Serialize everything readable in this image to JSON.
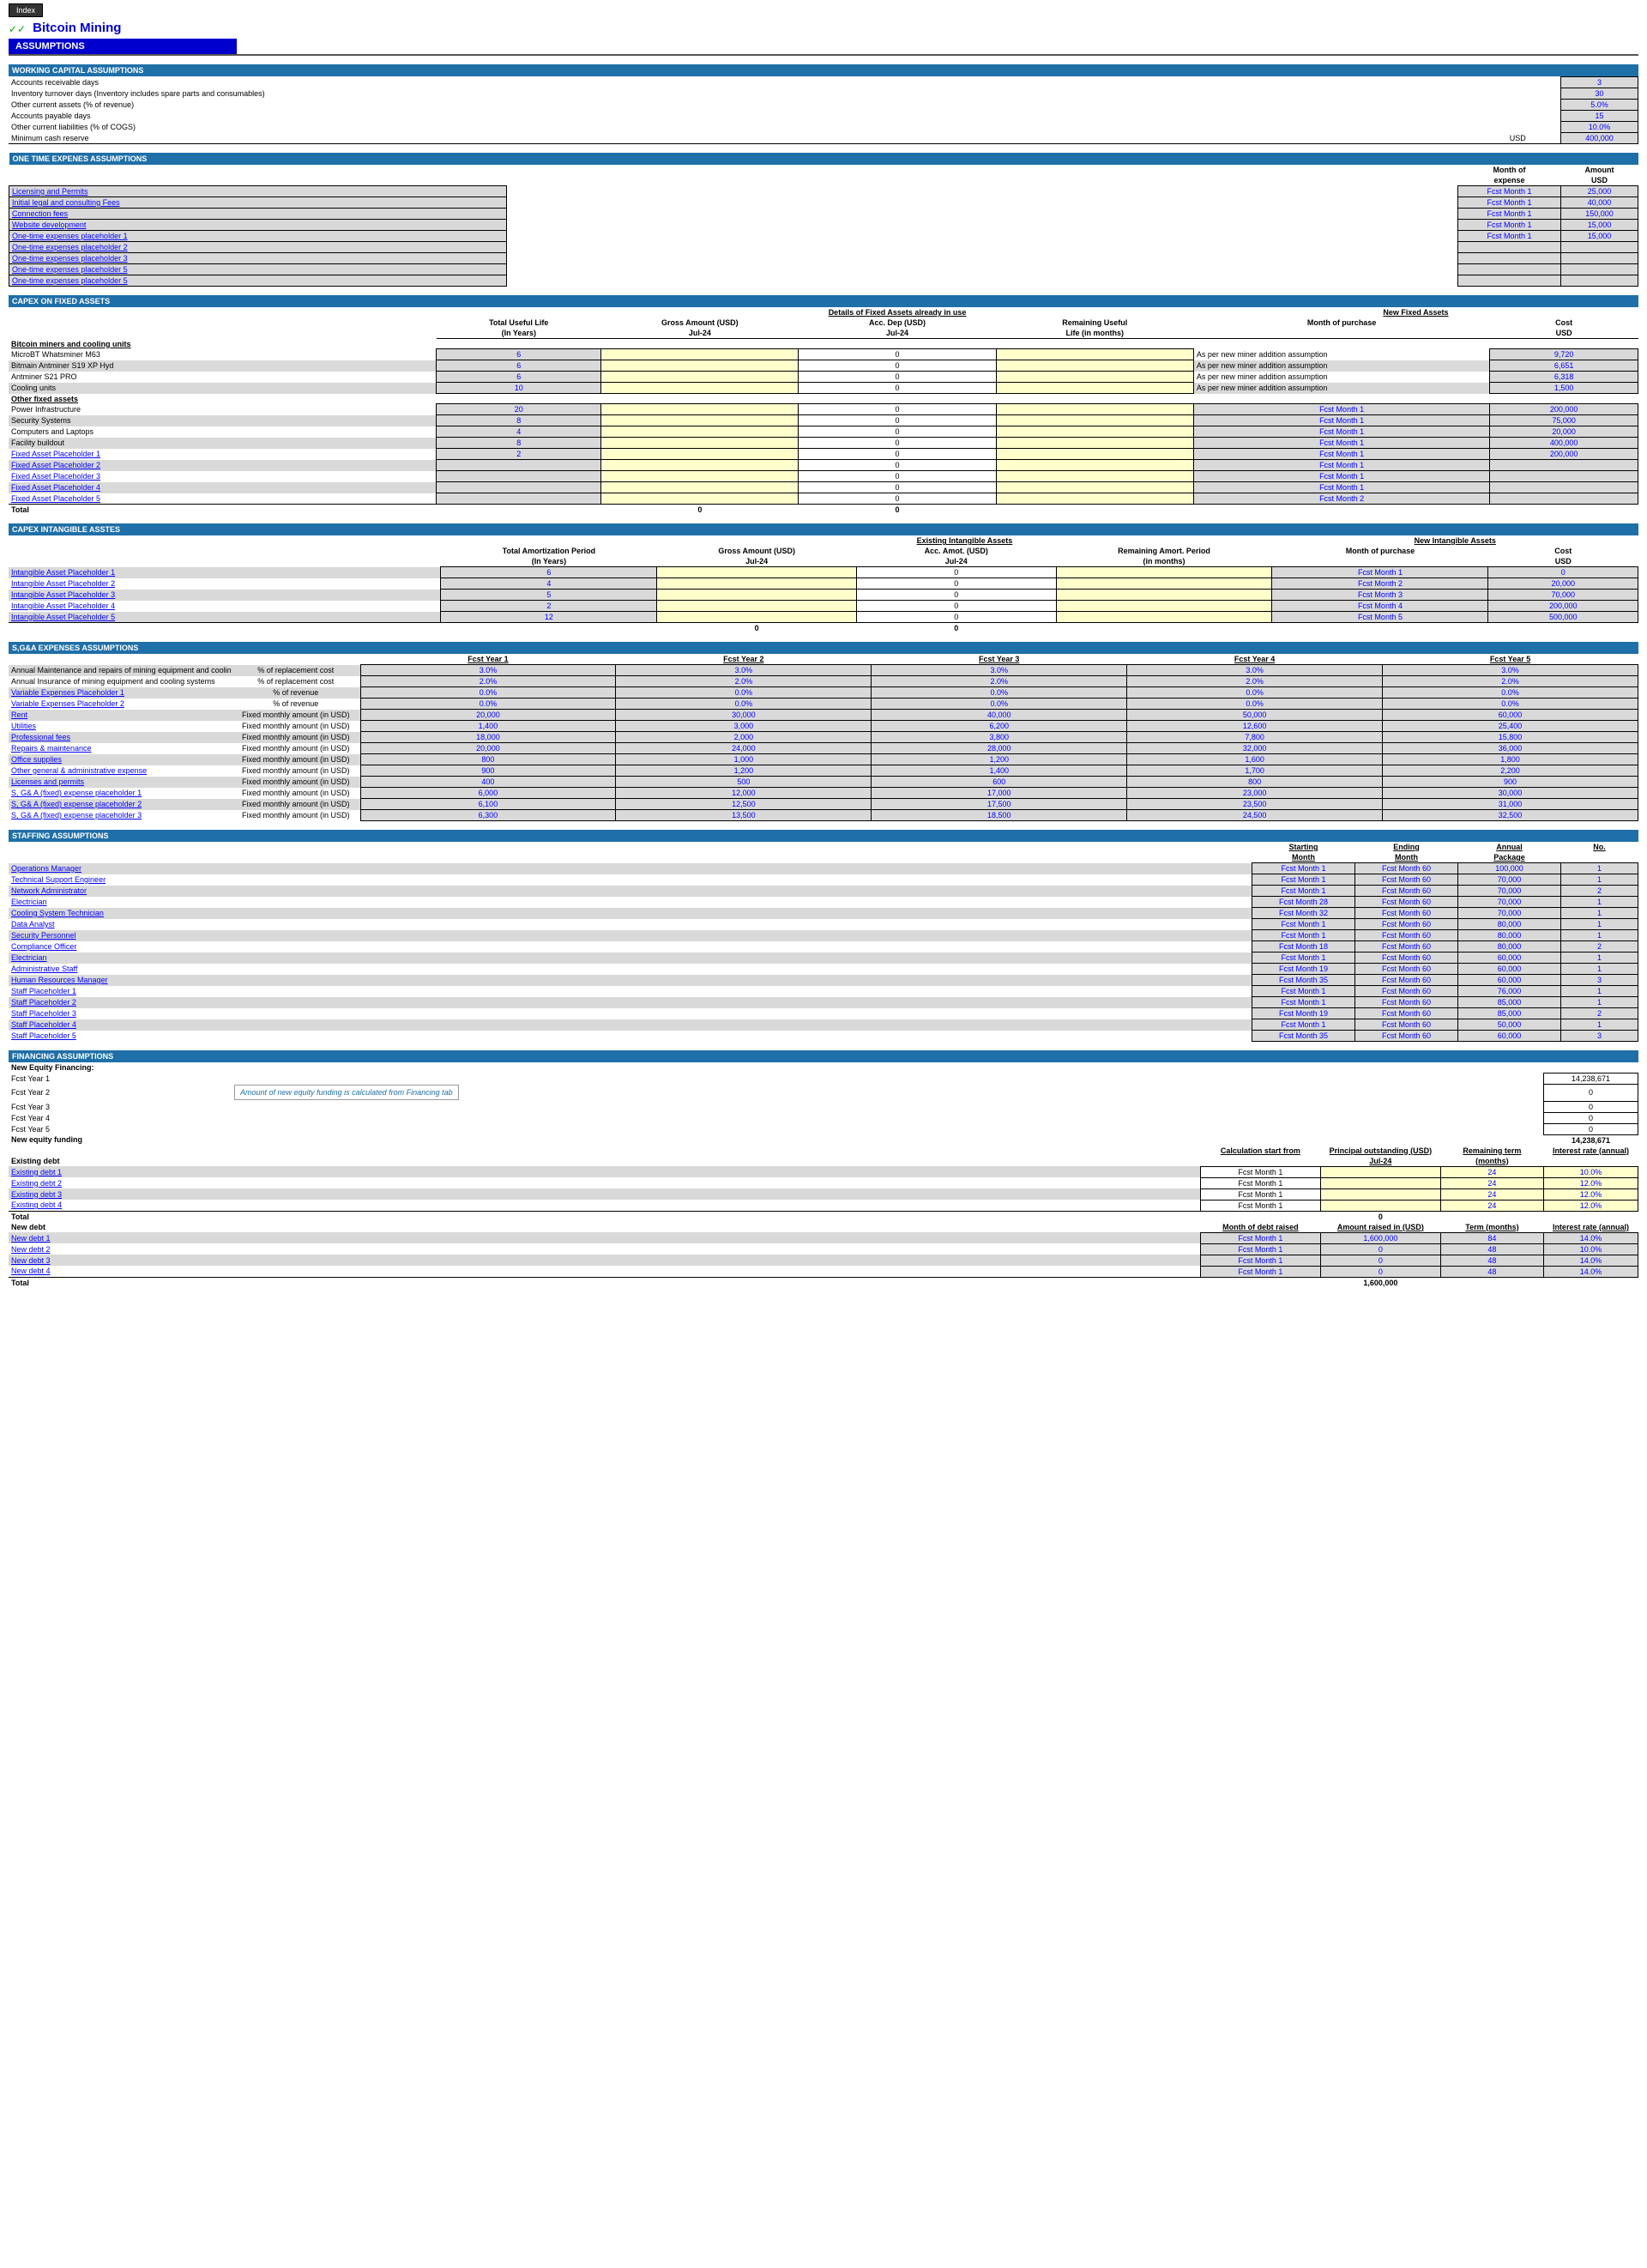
{
  "title": "Bitcoin Mining",
  "index": "Index",
  "assumptions": "ASSUMPTIONS",
  "wc": {
    "hdr": "WORKING CAPITAL ASSUMPTIONS",
    "rows": [
      {
        "l": "Accounts receivable days",
        "u": "",
        "v": "3"
      },
      {
        "l": "Inventory turnover days (Inventory includes spare parts and consumables)",
        "u": "",
        "v": "30"
      },
      {
        "l": "Other current assets (% of revenue)",
        "u": "",
        "v": "5.0%"
      },
      {
        "l": "Accounts payable days",
        "u": "",
        "v": "15"
      },
      {
        "l": "Other current liabilities (% of COGS)",
        "u": "",
        "v": "10.0%"
      },
      {
        "l": "Minimum cash reserve",
        "u": "USD",
        "v": "400,000"
      }
    ]
  },
  "ote": {
    "hdr": "ONE TIME EXPENES ASSUMPTIONS",
    "h1": "Month of",
    "h1b": "expense",
    "h2": "Amount",
    "h2b": "USD",
    "rows": [
      {
        "l": "Licensing and Permits",
        "m": "Fcst Month 1",
        "a": "25,000"
      },
      {
        "l": "Initial legal and consulting Fees",
        "m": "Fcst Month 1",
        "a": "40,000"
      },
      {
        "l": "Connection fees",
        "m": "Fcst Month 1",
        "a": "150,000"
      },
      {
        "l": "Website development",
        "m": "Fcst Month 1",
        "a": "15,000"
      },
      {
        "l": "One-time expenses placeholder 1",
        "m": "Fcst Month 1",
        "a": "15,000"
      },
      {
        "l": "One-time expenses placeholder 2",
        "m": "",
        "a": ""
      },
      {
        "l": "One-time expenses placeholder 3",
        "m": "",
        "a": ""
      },
      {
        "l": "One-time expenses placeholder 5",
        "m": "",
        "a": ""
      },
      {
        "l": "One-time expenses placeholder 5",
        "m": "",
        "a": ""
      }
    ]
  },
  "capfa": {
    "hdr": "CAPEX ON FIXED ASSETS",
    "h_det": "Details of Fixed Assets already in use",
    "h_new": "New Fixed Assets",
    "col1": "Total Useful Life",
    "col1b": "(In Years)",
    "col2": "Gross Amount (USD)",
    "col2b": "Jul-24",
    "col3": "Acc. Dep (USD)",
    "col3b": "Jul-24",
    "col4": "Remaining Useful",
    "col4b": "Life (in months)",
    "col5": "Month of purchase",
    "col6": "Cost",
    "col6b": "USD",
    "sub1": "Bitcoin miners and cooling units",
    "sub2": "Other fixed assets",
    "total": "Total",
    "miners": [
      {
        "l": "MicroBT Whatsminer M63",
        "y": "6",
        "dep": "0",
        "mop": "As per new miner addition assumption",
        "c": "9,720"
      },
      {
        "l": "Bitmain Antminer S19 XP Hyd",
        "y": "6",
        "dep": "0",
        "mop": "As per new miner addition assumption",
        "c": "6,651"
      },
      {
        "l": "Antminer S21 PRO",
        "y": "6",
        "dep": "0",
        "mop": "As per new miner addition assumption",
        "c": "6,318"
      },
      {
        "l": "Cooling units",
        "y": "10",
        "dep": "0",
        "mop": "As per new miner addition assumption",
        "c": "1,500"
      }
    ],
    "other": [
      {
        "l": "Power Infrastructure",
        "y": "20",
        "dep": "0",
        "mop": "Fcst Month 1",
        "c": "200,000"
      },
      {
        "l": "Security Systems",
        "y": "8",
        "dep": "0",
        "mop": "Fcst Month 1",
        "c": "75,000"
      },
      {
        "l": "Computers and Laptops",
        "y": "4",
        "dep": "0",
        "mop": "Fcst Month 1",
        "c": "20,000"
      },
      {
        "l": "Facility buildout",
        "y": "8",
        "dep": "0",
        "mop": "Fcst Month 1",
        "c": "400,000"
      },
      {
        "l": "Fixed Asset Placeholder 1",
        "y": "2",
        "dep": "0",
        "mop": "Fcst Month 1",
        "c": "200,000"
      },
      {
        "l": "Fixed Asset Placeholder 2",
        "y": "",
        "dep": "0",
        "mop": "Fcst Month 1",
        "c": ""
      },
      {
        "l": "Fixed Asset Placeholder 3",
        "y": "",
        "dep": "0",
        "mop": "Fcst Month 1",
        "c": ""
      },
      {
        "l": "Fixed Asset Placeholder 4",
        "y": "",
        "dep": "0",
        "mop": "Fcst Month 1",
        "c": ""
      },
      {
        "l": "Fixed Asset Placeholder 5",
        "y": "",
        "dep": "0",
        "mop": "Fcst Month 2",
        "c": ""
      }
    ],
    "tot_g": "0",
    "tot_d": "0"
  },
  "capia": {
    "hdr": "CAPEX INTANGIBLE ASSTES",
    "h_exist": "Existing Intangible Assets",
    "h_new": "New Intangible Assets",
    "col1": "Total Amortization Period",
    "col1b": "(In Years)",
    "col2": "Gross Amount (USD)",
    "col2b": "Jul-24",
    "col3": "Acc. Amot. (USD)",
    "col3b": "Jul-24",
    "col4": "Remaining Amort. Period",
    "col4b": "(in months)",
    "col5": "Month of purchase",
    "col6": "Cost",
    "col6b": "USD",
    "rows": [
      {
        "l": "Intangible Asset Placeholder 1",
        "y": "6",
        "dep": "0",
        "mop": "Fcst Month 1",
        "c": "0"
      },
      {
        "l": "Intangible Asset Placeholder 2",
        "y": "4",
        "dep": "0",
        "mop": "Fcst Month 2",
        "c": "20,000"
      },
      {
        "l": "Intangible Asset Placeholder 3",
        "y": "5",
        "dep": "0",
        "mop": "Fcst Month 3",
        "c": "70,000"
      },
      {
        "l": "Intangible Asset Placeholder 4",
        "y": "2",
        "dep": "0",
        "mop": "Fcst Month 4",
        "c": "200,000"
      },
      {
        "l": "Intangible Asset Placeholder 5",
        "y": "12",
        "dep": "0",
        "mop": "Fcst Month 5",
        "c": "500,000"
      }
    ],
    "tot_g": "0",
    "tot_d": "0"
  },
  "sga": {
    "hdr": "S,G&A EXPENSES ASSUMPTIONS",
    "yrs": [
      "Fcst Year 1",
      "Fcst Year 2",
      "Fcst Year 3",
      "Fcst Year 4",
      "Fcst Year 5"
    ],
    "rows": [
      {
        "l": "Annual Maintenance and repairs of  mining equipment and cooling systems",
        "t": "% of replacement cost",
        "v": [
          "3.0%",
          "3.0%",
          "3.0%",
          "3.0%",
          "3.0%"
        ],
        "link": 0
      },
      {
        "l": "Annual Insurance  of mining equipment and cooling systems",
        "t": "% of replacement cost",
        "v": [
          "2.0%",
          "2.0%",
          "2.0%",
          "2.0%",
          "2.0%"
        ],
        "link": 0
      },
      {
        "l": "Variable Expenses Placeholder 1",
        "t": "% of revenue",
        "v": [
          "0.0%",
          "0.0%",
          "0.0%",
          "0.0%",
          "0.0%"
        ],
        "link": 1
      },
      {
        "l": "Variable Expenses Placeholder 2",
        "t": "% of revenue",
        "v": [
          "0.0%",
          "0.0%",
          "0.0%",
          "0.0%",
          "0.0%"
        ],
        "link": 1
      },
      {
        "l": "Rent",
        "t": "Fixed monthly amount (in USD)",
        "v": [
          "20,000",
          "30,000",
          "40,000",
          "50,000",
          "60,000"
        ],
        "link": 1
      },
      {
        "l": "Utilities",
        "t": "Fixed monthly amount (in USD)",
        "v": [
          "1,400",
          "3,000",
          "6,200",
          "12,600",
          "25,400"
        ],
        "link": 1
      },
      {
        "l": "Professional fees",
        "t": "Fixed monthly amount (in USD)",
        "v": [
          "18,000",
          "2,000",
          "3,800",
          "7,800",
          "15,800"
        ],
        "link": 1
      },
      {
        "l": "Repairs & maintenance",
        "t": "Fixed monthly amount (in USD)",
        "v": [
          "20,000",
          "24,000",
          "28,000",
          "32,000",
          "36,000"
        ],
        "link": 1
      },
      {
        "l": "Office supplies",
        "t": "Fixed monthly amount (in USD)",
        "v": [
          "800",
          "1,000",
          "1,200",
          "1,600",
          "1,800"
        ],
        "link": 1
      },
      {
        "l": "Other general & administrative expense",
        "t": "Fixed monthly amount (in USD)",
        "v": [
          "900",
          "1,200",
          "1,400",
          "1,700",
          "2,200"
        ],
        "link": 1
      },
      {
        "l": "Licenses and permits",
        "t": "Fixed monthly amount (in USD)",
        "v": [
          "400",
          "500",
          "600",
          "800",
          "900"
        ],
        "link": 1
      },
      {
        "l": "S, G& A (fixed) expense placeholder 1",
        "t": "Fixed monthly amount (in USD)",
        "v": [
          "6,000",
          "12,000",
          "17,000",
          "23,000",
          "30,000"
        ],
        "link": 1
      },
      {
        "l": "S, G& A (fixed) expense placeholder 2",
        "t": "Fixed monthly amount (in USD)",
        "v": [
          "6,100",
          "12,500",
          "17,500",
          "23,500",
          "31,000"
        ],
        "link": 1
      },
      {
        "l": "S, G& A (fixed) expense placeholder 3",
        "t": "Fixed monthly amount (in USD)",
        "v": [
          "6,300",
          "13,500",
          "18,500",
          "24,500",
          "32,500"
        ],
        "link": 1
      }
    ]
  },
  "staff": {
    "hdr": "STAFFING ASSUMPTIONS",
    "h1": "Starting",
    "h1b": "Month",
    "h2": "Ending",
    "h2b": "Month",
    "h3": "Annual",
    "h3b": "Package",
    "h4": "No.",
    "rows": [
      {
        "l": "Operations Manager",
        "s": "Fcst Month 1",
        "e": "Fcst Month 60",
        "p": "100,000",
        "n": "1"
      },
      {
        "l": "Technical Support Engineer",
        "s": "Fcst Month 1",
        "e": "Fcst Month 60",
        "p": "70,000",
        "n": "1"
      },
      {
        "l": "Network Administrator",
        "s": "Fcst Month 1",
        "e": "Fcst Month 60",
        "p": "70,000",
        "n": "2"
      },
      {
        "l": "Electrician",
        "s": "Fcst Month 28",
        "e": "Fcst Month 60",
        "p": "70,000",
        "n": "1"
      },
      {
        "l": "Cooling System Technician",
        "s": "Fcst Month 32",
        "e": "Fcst Month 60",
        "p": "70,000",
        "n": "1"
      },
      {
        "l": "Data Analyst",
        "s": "Fcst Month 1",
        "e": "Fcst Month 60",
        "p": "80,000",
        "n": "1"
      },
      {
        "l": "Security Personnel",
        "s": "Fcst Month 1",
        "e": "Fcst Month 60",
        "p": "80,000",
        "n": "1"
      },
      {
        "l": "Compliance Officer",
        "s": "Fcst Month 18",
        "e": "Fcst Month 60",
        "p": "80,000",
        "n": "2"
      },
      {
        "l": "Electrician",
        "s": "Fcst Month 1",
        "e": "Fcst Month 60",
        "p": "60,000",
        "n": "1"
      },
      {
        "l": "Administrative Staff",
        "s": "Fcst Month 19",
        "e": "Fcst Month 60",
        "p": "60,000",
        "n": "1"
      },
      {
        "l": "Human Resources Manager",
        "s": "Fcst Month 35",
        "e": "Fcst Month 60",
        "p": "60,000",
        "n": "3"
      },
      {
        "l": "Staff Placeholder 1",
        "s": "Fcst Month 1",
        "e": "Fcst Month 60",
        "p": "76,000",
        "n": "1"
      },
      {
        "l": "Staff Placeholder 2",
        "s": "Fcst Month 1",
        "e": "Fcst Month 60",
        "p": "85,000",
        "n": "1"
      },
      {
        "l": "Staff Placeholder 3",
        "s": "Fcst Month 19",
        "e": "Fcst Month 60",
        "p": "85,000",
        "n": "2"
      },
      {
        "l": "Staff Placeholder 4",
        "s": "Fcst Month 1",
        "e": "Fcst Month 60",
        "p": "50,000",
        "n": "1"
      },
      {
        "l": "Staff Placeholder 5",
        "s": "Fcst Month 35",
        "e": "Fcst Month 60",
        "p": "60,000",
        "n": "3"
      }
    ]
  },
  "fin": {
    "hdr": "FINANCING ASSUMPTIONS",
    "nef": "New Equity Financing:",
    "yrs": [
      {
        "l": "Fcst Year 1",
        "v": "14,238,671"
      },
      {
        "l": "Fcst Year 2",
        "v": "0"
      },
      {
        "l": "Fcst Year 3",
        "v": "0"
      },
      {
        "l": "Fcst Year 4",
        "v": "0"
      },
      {
        "l": "Fcst Year 5",
        "v": "0"
      }
    ],
    "note": "Amount of new equity funding is calculated from Financing  tab",
    "neftot": "New equity funding",
    "neftotv": "14,238,671",
    "exdebt": "Existing debt",
    "exh1": "Calculation start from",
    "exh2": "Principal outstanding (USD)",
    "exh2b": "Jul-24",
    "exh3": "Remaining term",
    "exh3b": "(months)",
    "exh4": "Interest rate (annual)",
    "exrows": [
      {
        "l": "Existing debt 1",
        "m": "Fcst Month 1",
        "t": "24",
        "r": "10.0%"
      },
      {
        "l": "Existing debt 2",
        "m": "Fcst Month 1",
        "t": "24",
        "r": "12.0%"
      },
      {
        "l": "Existing debt 3",
        "m": "Fcst Month 1",
        "t": "24",
        "r": "12.0%"
      },
      {
        "l": "Existing debt 4",
        "m": "Fcst Month 1",
        "t": "24",
        "r": "12.0%"
      }
    ],
    "extot": "Total",
    "extotv": "0",
    "newdebt": "New debt",
    "ndh1": "Month of debt raised",
    "ndh2": "Amount raised in (USD)",
    "ndh3": "Term (months)",
    "ndh4": "Interest rate (annual)",
    "ndrows": [
      {
        "l": "New debt 1",
        "m": "Fcst Month 1",
        "a": "1,600,000",
        "t": "84",
        "r": "14.0%"
      },
      {
        "l": "New debt 2",
        "m": "Fcst Month 1",
        "a": "0",
        "t": "48",
        "r": "10.0%"
      },
      {
        "l": "New debt 3",
        "m": "Fcst Month 1",
        "a": "0",
        "t": "48",
        "r": "14.0%"
      },
      {
        "l": "New debt 4",
        "m": "Fcst Month 1",
        "a": "0",
        "t": "48",
        "r": "14.0%"
      }
    ],
    "ndtot": "Total",
    "ndtotv": "1,600,000"
  }
}
